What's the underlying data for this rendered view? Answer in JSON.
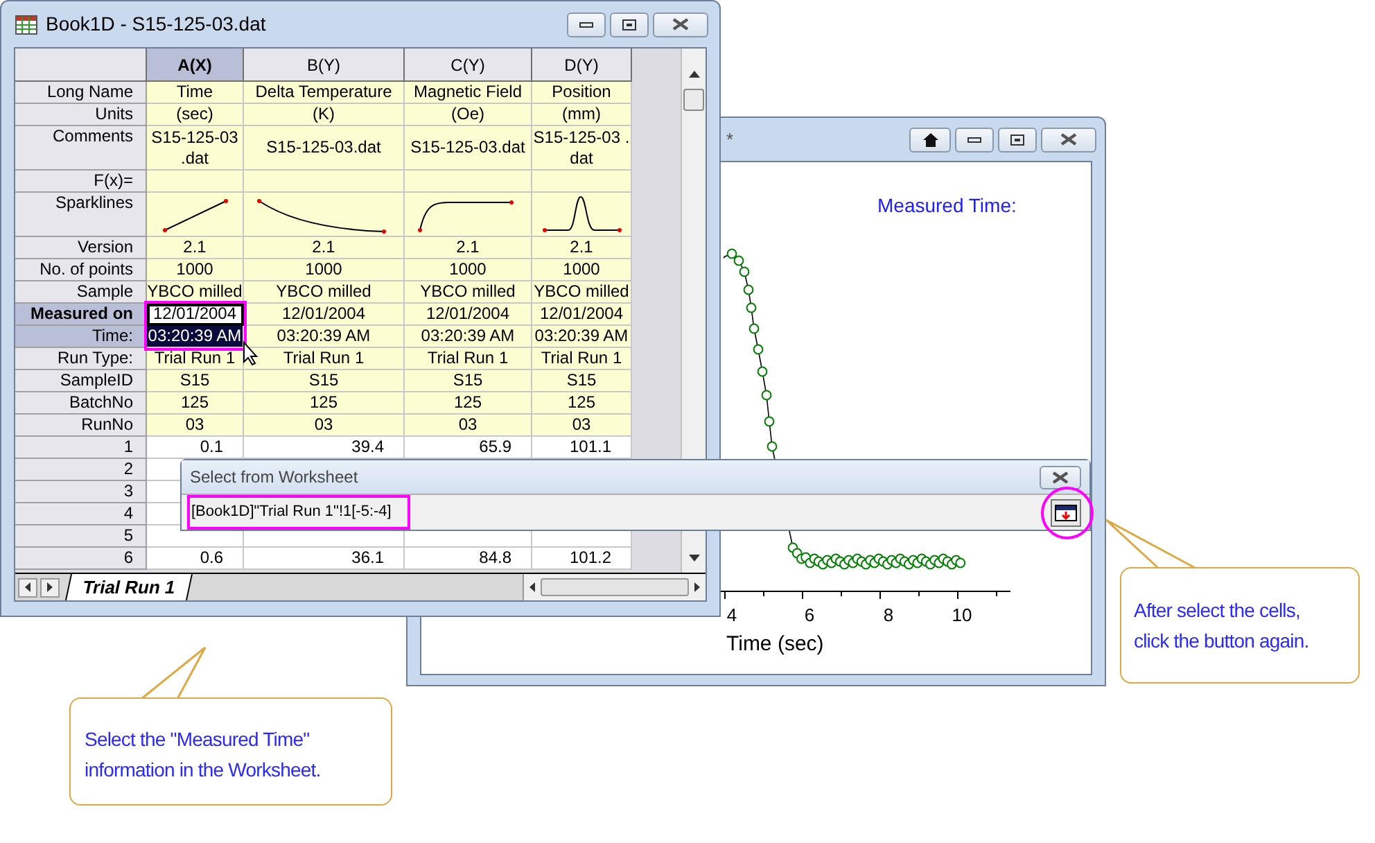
{
  "graph_window": {
    "title": "*",
    "annotation": "Measured Time:",
    "x_axis": {
      "tick_labels": [
        "4",
        "6",
        "8",
        "10"
      ],
      "title": "Time (sec)"
    }
  },
  "worksheet_window": {
    "title": "Book1D - S15-125-03.dat",
    "columns": [
      {
        "label": "A(X)",
        "selected": true
      },
      {
        "label": "B(Y)",
        "selected": false
      },
      {
        "label": "C(Y)",
        "selected": false
      },
      {
        "label": "D(Y)",
        "selected": false
      }
    ],
    "label_rows": [
      {
        "label": "Long Name",
        "selected": false,
        "cells": [
          {
            "text": "Time",
            "selected": false
          },
          {
            "text": "Delta Temperature",
            "selected": false
          },
          {
            "text": "Magnetic Field",
            "selected": false
          },
          {
            "text": "Position",
            "selected": false
          }
        ]
      },
      {
        "label": "Units",
        "selected": false,
        "cells": [
          {
            "text": "(sec)",
            "selected": false
          },
          {
            "text": "(K)",
            "selected": false
          },
          {
            "text": "(Oe)",
            "selected": false
          },
          {
            "text": "(mm)",
            "selected": false
          }
        ]
      },
      {
        "label": "Comments",
        "selected": false,
        "tall": true,
        "cells": [
          {
            "text": "S15-125-03 .dat",
            "selected": false
          },
          {
            "text": "S15-125-03.dat",
            "selected": false
          },
          {
            "text": "S15-125-03.dat",
            "selected": false
          },
          {
            "text": "S15-125-03 .dat",
            "selected": false
          }
        ]
      },
      {
        "label": "F(x)=",
        "selected": false
      },
      {
        "label": "Sparklines",
        "selected": false,
        "tall": true,
        "sparklines": [
          {
            "kind": "rising"
          },
          {
            "kind": "decay"
          },
          {
            "kind": "saturation"
          },
          {
            "kind": "peak"
          }
        ]
      },
      {
        "label": "Version",
        "selected": false,
        "cells": [
          {
            "text": "2.1",
            "selected": false
          },
          {
            "text": "2.1",
            "selected": false
          },
          {
            "text": "2.1",
            "selected": false
          },
          {
            "text": "2.1",
            "selected": false
          }
        ]
      },
      {
        "label": "No. of points",
        "selected": false,
        "cells": [
          {
            "text": "1000",
            "selected": false
          },
          {
            "text": "1000",
            "selected": false
          },
          {
            "text": "1000",
            "selected": false
          },
          {
            "text": "1000",
            "selected": false
          }
        ]
      },
      {
        "label": "Sample",
        "selected": false,
        "cells": [
          {
            "text": "YBCO milled",
            "selected": false
          },
          {
            "text": "YBCO milled",
            "selected": false
          },
          {
            "text": "YBCO milled",
            "selected": false
          },
          {
            "text": "YBCO milled",
            "selected": false
          }
        ]
      },
      {
        "label": "Measured on",
        "selected": true,
        "cells": [
          {
            "text": "12/01/2004",
            "selected": true
          },
          {
            "text": "12/01/2004",
            "selected": false
          },
          {
            "text": "12/01/2004",
            "selected": false
          },
          {
            "text": "12/01/2004",
            "selected": false
          }
        ]
      },
      {
        "label": "Time:",
        "selected": true,
        "cells": [
          {
            "text": "03:20:39 AM",
            "selected": true
          },
          {
            "text": "03:20:39 AM",
            "selected": false
          },
          {
            "text": "03:20:39 AM",
            "selected": false
          },
          {
            "text": "03:20:39 AM",
            "selected": false
          }
        ]
      },
      {
        "label": "Run Type:",
        "selected": false,
        "cells": [
          {
            "text": "Trial Run 1",
            "selected": false
          },
          {
            "text": "Trial Run 1",
            "selected": false
          },
          {
            "text": "Trial Run 1",
            "selected": false
          },
          {
            "text": "Trial Run 1",
            "selected": false
          }
        ]
      },
      {
        "label": "SampleID",
        "selected": false,
        "cells": [
          {
            "text": "S15",
            "selected": false
          },
          {
            "text": "S15",
            "selected": false
          },
          {
            "text": "S15",
            "selected": false
          },
          {
            "text": "S15",
            "selected": false
          }
        ]
      },
      {
        "label": "BatchNo",
        "selected": false,
        "cells": [
          {
            "text": "125",
            "selected": false
          },
          {
            "text": "125",
            "selected": false
          },
          {
            "text": "125",
            "selected": false
          },
          {
            "text": "125",
            "selected": false
          }
        ]
      },
      {
        "label": "RunNo",
        "selected": false,
        "cells": [
          {
            "text": "03",
            "selected": false
          },
          {
            "text": "03",
            "selected": false
          },
          {
            "text": "03",
            "selected": false
          },
          {
            "text": "03",
            "selected": false
          }
        ]
      }
    ],
    "data_rows": [
      {
        "label": "1",
        "cells": [
          "0.1",
          "39.4",
          "65.9",
          "101.1"
        ]
      },
      {
        "label": "2"
      },
      {
        "label": "3"
      },
      {
        "label": "4"
      },
      {
        "label": "5"
      },
      {
        "label": "6",
        "cells": [
          "0.6",
          "36.1",
          "84.8",
          "101.2"
        ]
      }
    ],
    "sheet_tabs": [
      {
        "label": "Trial Run 1",
        "selected": true
      }
    ]
  },
  "dialog": {
    "title": "Select from Worksheet",
    "value": "[Book1D]\"Trial Run 1\"!1[-5:-4]"
  },
  "callouts": [
    {
      "text": "Select the \"Measured Time\" information in the Worksheet."
    },
    {
      "text": "After select the cells, click the button again."
    }
  ]
}
